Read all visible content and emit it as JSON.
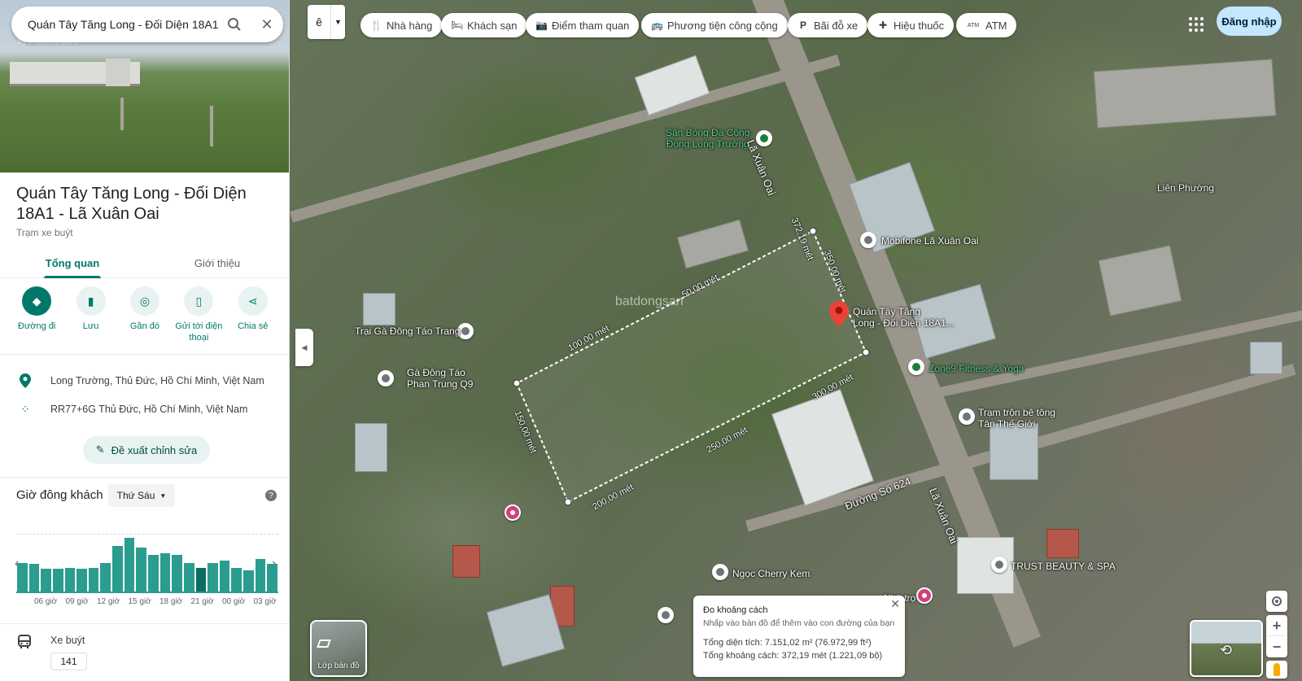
{
  "search": {
    "value": "Quán Tây Tăng Long - Đối Diện 18A1"
  },
  "hero": {
    "watermark": "by PropertyGuru"
  },
  "place": {
    "title": "Quán Tây Tăng Long - Đối Diện 18A1 - Lã Xuân Oai",
    "type": "Trạm xe buýt"
  },
  "tabs": [
    {
      "label": "Tổng quan"
    },
    {
      "label": "Giới thiệu"
    }
  ],
  "actions": [
    {
      "label": "Đường đi",
      "icon": "directions-icon"
    },
    {
      "label": "Lưu",
      "icon": "bookmark-icon"
    },
    {
      "label": "Gần đó",
      "icon": "nearby-icon"
    },
    {
      "label": "Gửi tới điện thoại",
      "icon": "send-to-phone-icon"
    },
    {
      "label": "Chia sẻ",
      "icon": "share-icon"
    }
  ],
  "info": {
    "address": "Long Trường, Thủ Đức, Hồ Chí Minh, Việt Nam",
    "plus_code": "RR77+6G Thủ Đức, Hồ Chí Minh, Việt Nam"
  },
  "suggest_edit": "Đề xuất chỉnh sửa",
  "popular_times": {
    "title": "Giờ đông khách",
    "day": "Thứ Sáu",
    "hour_labels": [
      "06 giờ",
      "09 giờ",
      "12 giờ",
      "15 giờ",
      "18 giờ",
      "21 giờ",
      "00 giờ",
      "03 giờ"
    ],
    "bars": [
      0.52,
      0.5,
      0.42,
      0.42,
      0.43,
      0.42,
      0.43,
      0.52,
      0.82,
      0.96,
      0.78,
      0.66,
      0.68,
      0.66,
      0.52,
      0.43,
      0.52,
      0.55,
      0.43,
      0.38,
      0.58,
      0.5
    ],
    "current_index": 15
  },
  "transit": {
    "label": "Xe buýt",
    "route": "141"
  },
  "chips": [
    {
      "label": "Nhà hàng",
      "icon": "restaurant-icon",
      "glyph": "🍴"
    },
    {
      "label": "Khách sạn",
      "icon": "hotel-icon",
      "glyph": "🛏"
    },
    {
      "label": "Điểm tham quan",
      "icon": "camera-icon",
      "glyph": "📷"
    },
    {
      "label": "Phương tiện công cộng",
      "icon": "transit-icon",
      "glyph": "🚌"
    },
    {
      "label": "Bãi đỗ xe",
      "icon": "parking-icon",
      "glyph": "P"
    },
    {
      "label": "Hiệu thuốc",
      "icon": "pharmacy-icon",
      "glyph": "✚"
    },
    {
      "label": "ATM",
      "icon": "atm-icon",
      "glyph": "ATM"
    }
  ],
  "signin": "Đăng nhập",
  "map_labels": {
    "san_bong": "Sân Bóng Đá Cộng\nĐồng Long Trường",
    "road_main": "Lã Xuân Oai",
    "lien_phuong": "Liên Phường",
    "mobifone": "Mobifone Lã Xuân Oai",
    "selected_place": "Quán Tây Tăng\nLong - Đối Diện 18A1...",
    "trai_ga": "Trại Gà Đông Táo Trang",
    "ga_dong_tao": "Gà Đông Táo\nPhan Trung Q9",
    "zone9": "Zone9 Fitness & Yoga",
    "tram_tron": "Trạm trộn bê tông\nTân Thế Giới",
    "duong_624": "Đường Số 624",
    "road_main_2": "Lã Xuân Oai",
    "ngoc_cherry": "Ngọc Cherry Kem",
    "nha_tro": "Nhà trọ",
    "trust_beauty": "TRUST BEAUTY & SPA",
    "watermark": "batdongsan"
  },
  "distances": [
    "372,19 mét",
    "350,00 mét",
    "50,00 mét",
    "100,00 mét",
    "150,00 mét",
    "200,00 mét",
    "250,00 mét",
    "300,00 mét"
  ],
  "measure": {
    "title": "Đo khoảng cách",
    "hint": "Nhấp vào bản đồ để thêm vào con đường của bạn",
    "area": "Tổng diện tích: 7.151,02 m² (76.972,99 ft²)",
    "total": "Tổng khoảng cách: 372,19 mét (1.221,09 bộ)"
  },
  "layers_label": "Lớp bản đồ",
  "layer_select_glyph": "ê",
  "colors": {
    "accent": "#00796b",
    "signin_bg": "#c2e7ff",
    "pin": "#ea4335"
  }
}
